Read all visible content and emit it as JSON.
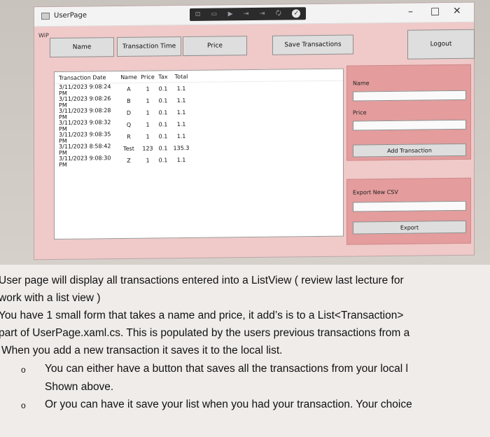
{
  "window": {
    "title": "UserPage",
    "partial_label": "WiP",
    "controls": {
      "minimize": "–",
      "maximize": "□",
      "close": "✕"
    },
    "debug_toolbar": {
      "items": [
        "⊡",
        "▭",
        "▶",
        "⇥",
        "⇥",
        "🗘"
      ],
      "check": "✓"
    }
  },
  "toolbar": {
    "name_label": "Name",
    "time_label": "Transaction Time",
    "price_label": "Price",
    "save_label": "Save Transactions",
    "logout_label": "Logout"
  },
  "listview": {
    "columns": [
      "Transaction Date",
      "Name",
      "Price",
      "Tax",
      "Total"
    ],
    "rows": [
      [
        "3/11/2023 9:08:24 PM",
        "A",
        "1",
        "0.1",
        "1.1"
      ],
      [
        "3/11/2023 9:08:26 PM",
        "B",
        "1",
        "0.1",
        "1.1"
      ],
      [
        "3/11/2023 9:08:28 PM",
        "D",
        "1",
        "0.1",
        "1.1"
      ],
      [
        "3/11/2023 9:08:32 PM",
        "Q",
        "1",
        "0.1",
        "1.1"
      ],
      [
        "3/11/2023 9:08:35 PM",
        "R",
        "1",
        "0.1",
        "1.1"
      ],
      [
        "3/11/2023 8:58:42 PM",
        "Test",
        "123",
        "0.1",
        "135.3"
      ],
      [
        "3/11/2023 9:08:30 PM",
        "Z",
        "1",
        "0.1",
        "1.1"
      ]
    ]
  },
  "form": {
    "name_label": "Name",
    "name_value": "",
    "price_label": "Price",
    "price_value": "",
    "add_label": "Add Transaction"
  },
  "export": {
    "label": "Export New CSV",
    "value": "",
    "button_label": "Export"
  },
  "document": {
    "lines": [
      "User page will display all transactions entered into a ListView ( review last lecture for",
      "work with a list view )",
      "You have 1 small form that takes a name and price, it add’s is to a List<Transaction>",
      "part of UserPage.xaml.cs. This is populated by the users previous transactions from a",
      "When you add a new transaction it saves it to the local list."
    ],
    "bullets": [
      {
        "marker": "o",
        "text": "You can either have a button that saves all the transactions from your local l"
      },
      {
        "marker": "",
        "text": "Shown above."
      },
      {
        "marker": "o",
        "text": "Or you can have it save your list when you had your transaction. Your choice"
      }
    ]
  }
}
